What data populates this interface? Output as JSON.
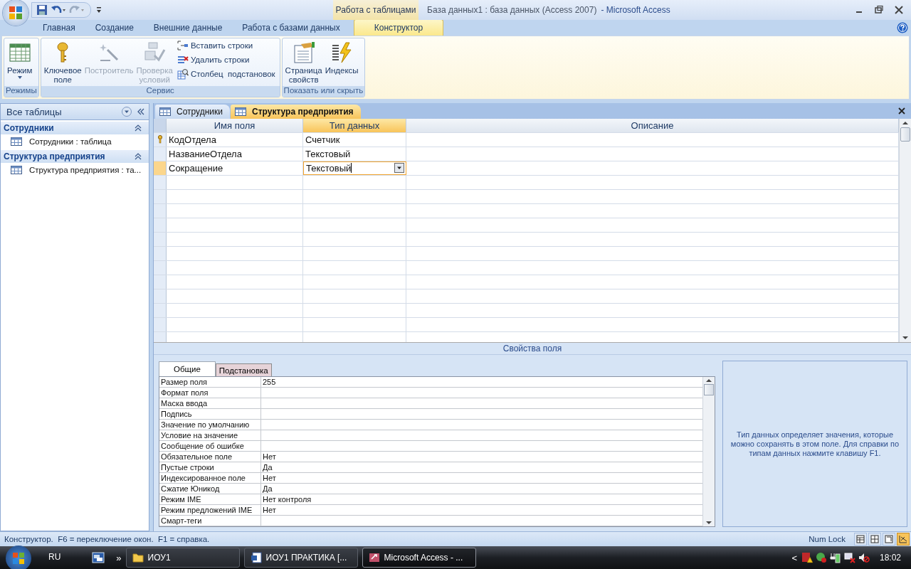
{
  "title_bar": {
    "contextual_tab": "Работа с таблицами",
    "title": "База данных1 : база данных (Access 2007)",
    "app": "- Microsoft Access"
  },
  "ribbon_tabs": [
    {
      "label": "Главная",
      "selected": false
    },
    {
      "label": "Создание",
      "selected": false
    },
    {
      "label": "Внешние данные",
      "selected": false
    },
    {
      "label": "Работа с базами данных",
      "selected": false
    },
    {
      "label": "Конструктор",
      "selected": true
    }
  ],
  "ribbon_groups": [
    {
      "label": "Режимы",
      "large": [
        {
          "label": "Режим",
          "kind": "dropdown",
          "disabled": false
        }
      ]
    },
    {
      "label": "Сервис",
      "large": [
        {
          "label": "Ключевое поле",
          "kind": "button",
          "disabled": false
        },
        {
          "label": "Построитель",
          "kind": "button",
          "disabled": true
        },
        {
          "label": "Проверка условий",
          "kind": "button",
          "disabled": true
        }
      ],
      "small": [
        {
          "label": "Вставить строки",
          "disabled": false
        },
        {
          "label": "Удалить строки",
          "disabled": false
        },
        {
          "label": "Столбец  подстановок",
          "disabled": false
        }
      ]
    },
    {
      "label": "Показать или скрыть",
      "large": [
        {
          "label": "Страница свойств",
          "kind": "button",
          "disabled": false
        },
        {
          "label": "Индексы",
          "kind": "button",
          "disabled": false
        }
      ]
    }
  ],
  "nav_pane": {
    "title": "Все таблицы",
    "groups": [
      {
        "label": "Сотрудники",
        "items": [
          "Сотрудники : таблица"
        ]
      },
      {
        "label": "Структура предприятия",
        "items": [
          "Структура предприятия : та..."
        ]
      }
    ]
  },
  "document_tabs": [
    {
      "label": "Сотрудники",
      "selected": false
    },
    {
      "label": "Структура предприятия",
      "selected": true
    }
  ],
  "design_grid": {
    "columns": [
      "Имя поля",
      "Тип данных",
      "Описание"
    ],
    "rows": [
      {
        "name": "КодОтдела",
        "type": "Счетчик",
        "primary_key": true,
        "selected": false
      },
      {
        "name": "НазваниеОтдела",
        "type": "Текстовый",
        "primary_key": false,
        "selected": false
      },
      {
        "name": "Сокращение",
        "type": "Текстовый",
        "primary_key": false,
        "selected": true
      }
    ]
  },
  "field_properties": {
    "title": "Свойства поля",
    "tabs": [
      {
        "label": "Общие",
        "selected": true
      },
      {
        "label": "Подстановка",
        "selected": false
      }
    ],
    "rows": [
      {
        "name": "Размер поля",
        "value": "255"
      },
      {
        "name": "Формат поля"
      },
      {
        "name": "Маска ввода"
      },
      {
        "name": "Подпись"
      },
      {
        "name": "Значение по умолчанию"
      },
      {
        "name": "Условие на значение"
      },
      {
        "name": "Сообщение об ошибке"
      },
      {
        "name": "Обязательное поле",
        "value": "Нет"
      },
      {
        "name": "Пустые строки",
        "value": "Да"
      },
      {
        "name": "Индексированное поле",
        "value": "Нет"
      },
      {
        "name": "Сжатие Юникод",
        "value": "Да"
      },
      {
        "name": "Режим IME",
        "value": "Нет контроля"
      },
      {
        "name": "Режим предложений IME",
        "value": "Нет"
      },
      {
        "name": "Смарт-теги"
      }
    ],
    "help": "Тип данных определяет значения, которые можно сохранять в этом поле.  Для справки по типам данных нажмите клавишу F1."
  },
  "status_bar": {
    "text": "Конструктор.  F6 = переключение окон.  F1 = справка.",
    "num_lock": "Num Lock",
    "view_buttons": [
      {
        "selected": false
      },
      {
        "selected": false
      },
      {
        "selected": false
      },
      {
        "selected": true
      }
    ]
  },
  "taskbar": {
    "language": "RU",
    "more": "»",
    "tasks": [
      {
        "label": "ИОУ1",
        "kind": "folder",
        "selected": false
      },
      {
        "label": "ИОУ1 ПРАКТИКА [...",
        "kind": "document",
        "selected": false
      },
      {
        "label": "Microsoft Access - ...",
        "kind": "database",
        "selected": true
      }
    ],
    "tray_expand": "<",
    "clock": "18:02"
  }
}
